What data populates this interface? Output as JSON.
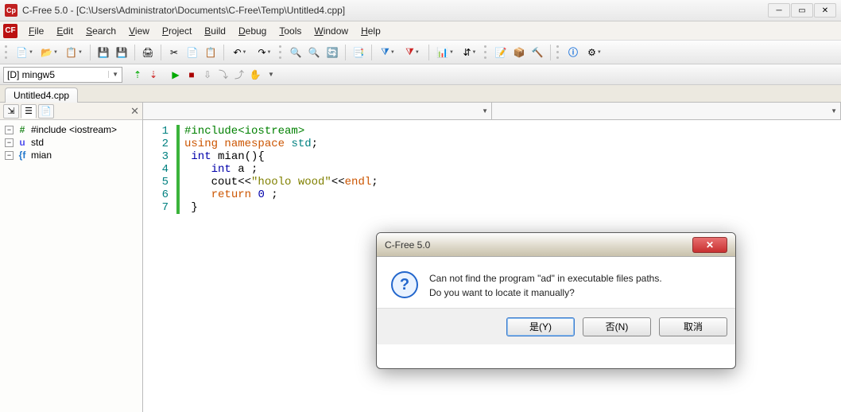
{
  "window": {
    "app_glyph": "Cp",
    "title": "C-Free 5.0 - [C:\\Users\\Administrator\\Documents\\C-Free\\Temp\\Untitled4.cpp]"
  },
  "menu": {
    "app_glyph": "CF",
    "items": [
      "File",
      "Edit",
      "Search",
      "View",
      "Project",
      "Build",
      "Debug",
      "Tools",
      "Window",
      "Help"
    ]
  },
  "compiler_combo": "[D] mingw5",
  "tabs": {
    "file": "Untitled4.cpp"
  },
  "tree": {
    "nodes": [
      {
        "icon": "#",
        "color": "#228822",
        "label": "#include <iostream>"
      },
      {
        "icon": "u",
        "color": "#5050ee",
        "label": "std"
      },
      {
        "icon": "{f",
        "color": "#2277cc",
        "label": "mian"
      }
    ]
  },
  "code": {
    "lines": [
      {
        "n": "1",
        "segs": [
          {
            "c": "kw-prep",
            "t": "#include"
          },
          {
            "c": "kw-prep",
            "t": "<iostream>"
          }
        ]
      },
      {
        "n": "2",
        "segs": [
          {
            "c": "kw2",
            "t": "using"
          },
          {
            "c": "id",
            "t": " "
          },
          {
            "c": "kw2",
            "t": "namespace"
          },
          {
            "c": "id",
            "t": " "
          },
          {
            "c": "namespace",
            "t": "std"
          },
          {
            "c": "id",
            "t": ";"
          }
        ]
      },
      {
        "n": "3",
        "segs": [
          {
            "c": "id",
            "t": " "
          },
          {
            "c": "kw",
            "t": "int"
          },
          {
            "c": "id",
            "t": " mian(){"
          }
        ]
      },
      {
        "n": "4",
        "segs": [
          {
            "c": "id",
            "t": "    "
          },
          {
            "c": "kw",
            "t": "int"
          },
          {
            "c": "id",
            "t": " a ;"
          }
        ]
      },
      {
        "n": "5",
        "segs": [
          {
            "c": "id",
            "t": "    cout<<"
          },
          {
            "c": "str",
            "t": "\"hoolo wood\""
          },
          {
            "c": "id",
            "t": "<<"
          },
          {
            "c": "kw2",
            "t": "endl"
          },
          {
            "c": "id",
            "t": ";"
          }
        ]
      },
      {
        "n": "6",
        "segs": [
          {
            "c": "id",
            "t": "    "
          },
          {
            "c": "kw2",
            "t": "return"
          },
          {
            "c": "id",
            "t": " "
          },
          {
            "c": "kw",
            "t": "0"
          },
          {
            "c": "id",
            "t": " ;"
          }
        ]
      },
      {
        "n": "7",
        "segs": [
          {
            "c": "id",
            "t": " }"
          }
        ]
      }
    ]
  },
  "dialog": {
    "title": "C-Free 5.0",
    "line1": "Can not find the program \"ad\" in executable files paths.",
    "line2": "Do you want to locate it manually?",
    "yes": "是(Y)",
    "no": "否(N)",
    "cancel": "取消"
  }
}
